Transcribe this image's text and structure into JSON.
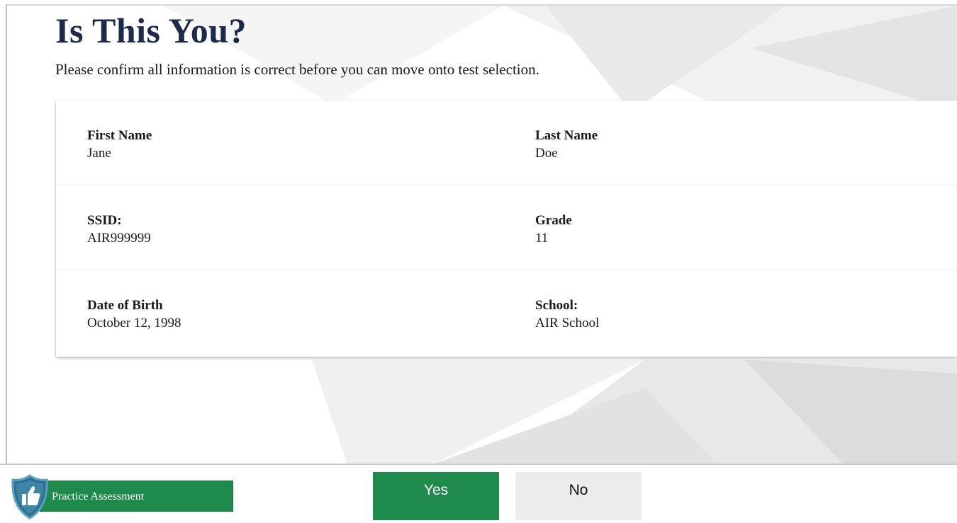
{
  "page": {
    "title": "Is This You?",
    "subtitle": "Please confirm all information is correct before you can move onto test selection."
  },
  "student": {
    "rows": [
      [
        {
          "label": "First Name",
          "value": "Jane"
        },
        {
          "label": "Last Name",
          "value": "Doe"
        }
      ],
      [
        {
          "label": "SSID:",
          "value": "AIR999999"
        },
        {
          "label": "Grade",
          "value": "11"
        }
      ],
      [
        {
          "label": "Date of Birth",
          "value": "October 12, 1998"
        },
        {
          "label": "School:",
          "value": "AIR School"
        }
      ]
    ]
  },
  "footer": {
    "brand_label": "Practice Assessment",
    "brand_icon": "shield-thumbs-up-icon",
    "yes_label": "Yes",
    "no_label": "No"
  },
  "colors": {
    "title": "#1c2a4d",
    "primary_green": "#1e8a4c",
    "secondary_gray": "#ececec"
  }
}
